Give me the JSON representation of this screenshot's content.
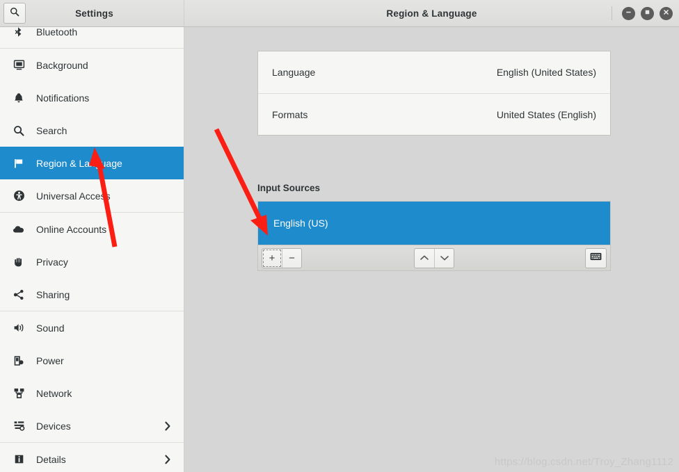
{
  "window": {
    "title": "Region & Language",
    "sidebar_title": "Settings",
    "controls": [
      {
        "name": "minimize",
        "glyph": "minimize-icon"
      },
      {
        "name": "maximize",
        "glyph": "maximize-icon"
      },
      {
        "name": "close",
        "glyph": "close-icon"
      }
    ],
    "search_icon": "search-icon"
  },
  "sidebar": {
    "items": [
      {
        "label": "Bluetooth",
        "icon": "bluetooth-icon",
        "selected": false,
        "chevron": false,
        "separator_after": true
      },
      {
        "label": "Background",
        "icon": "background-icon",
        "selected": false,
        "chevron": false,
        "separator_after": false
      },
      {
        "label": "Notifications",
        "icon": "bell-icon",
        "selected": false,
        "chevron": false,
        "separator_after": false
      },
      {
        "label": "Search",
        "icon": "search-icon",
        "selected": false,
        "chevron": false,
        "separator_after": false
      },
      {
        "label": "Region & Language",
        "icon": "flag-icon",
        "selected": true,
        "chevron": false,
        "separator_after": false
      },
      {
        "label": "Universal Access",
        "icon": "accessibility-icon",
        "selected": false,
        "chevron": false,
        "separator_after": true
      },
      {
        "label": "Online Accounts",
        "icon": "cloud-icon",
        "selected": false,
        "chevron": false,
        "separator_after": false
      },
      {
        "label": "Privacy",
        "icon": "hand-icon",
        "selected": false,
        "chevron": false,
        "separator_after": false
      },
      {
        "label": "Sharing",
        "icon": "share-icon",
        "selected": false,
        "chevron": false,
        "separator_after": true
      },
      {
        "label": "Sound",
        "icon": "speaker-icon",
        "selected": false,
        "chevron": false,
        "separator_after": false
      },
      {
        "label": "Power",
        "icon": "power-battery-icon",
        "selected": false,
        "chevron": false,
        "separator_after": false
      },
      {
        "label": "Network",
        "icon": "network-icon",
        "selected": false,
        "chevron": false,
        "separator_after": false
      },
      {
        "label": "Devices",
        "icon": "devices-icon",
        "selected": false,
        "chevron": true,
        "separator_after": true
      },
      {
        "label": "Details",
        "icon": "info-icon",
        "selected": false,
        "chevron": true,
        "separator_after": false
      }
    ]
  },
  "main": {
    "settings_rows": [
      {
        "label": "Language",
        "value": "English (United States)"
      },
      {
        "label": "Formats",
        "value": "United States (English)"
      }
    ],
    "input_sources": {
      "section_label": "Input Sources",
      "items": [
        {
          "label": "English (US)",
          "selected": true
        }
      ],
      "toolbar": {
        "add_label": "+",
        "remove_label": "−",
        "move_up_icon": "chevron-up-icon",
        "move_down_icon": "chevron-down-icon",
        "preview_icon": "keyboard-icon"
      }
    }
  },
  "watermark": {
    "text": "https://blog.csdn.net/Troy_Zhang1112"
  },
  "colors": {
    "accent": "#1e8bcd",
    "annotation": "#fa1e14",
    "content_bg": "#d6d6d6",
    "sidebar_bg": "#f6f6f5"
  }
}
